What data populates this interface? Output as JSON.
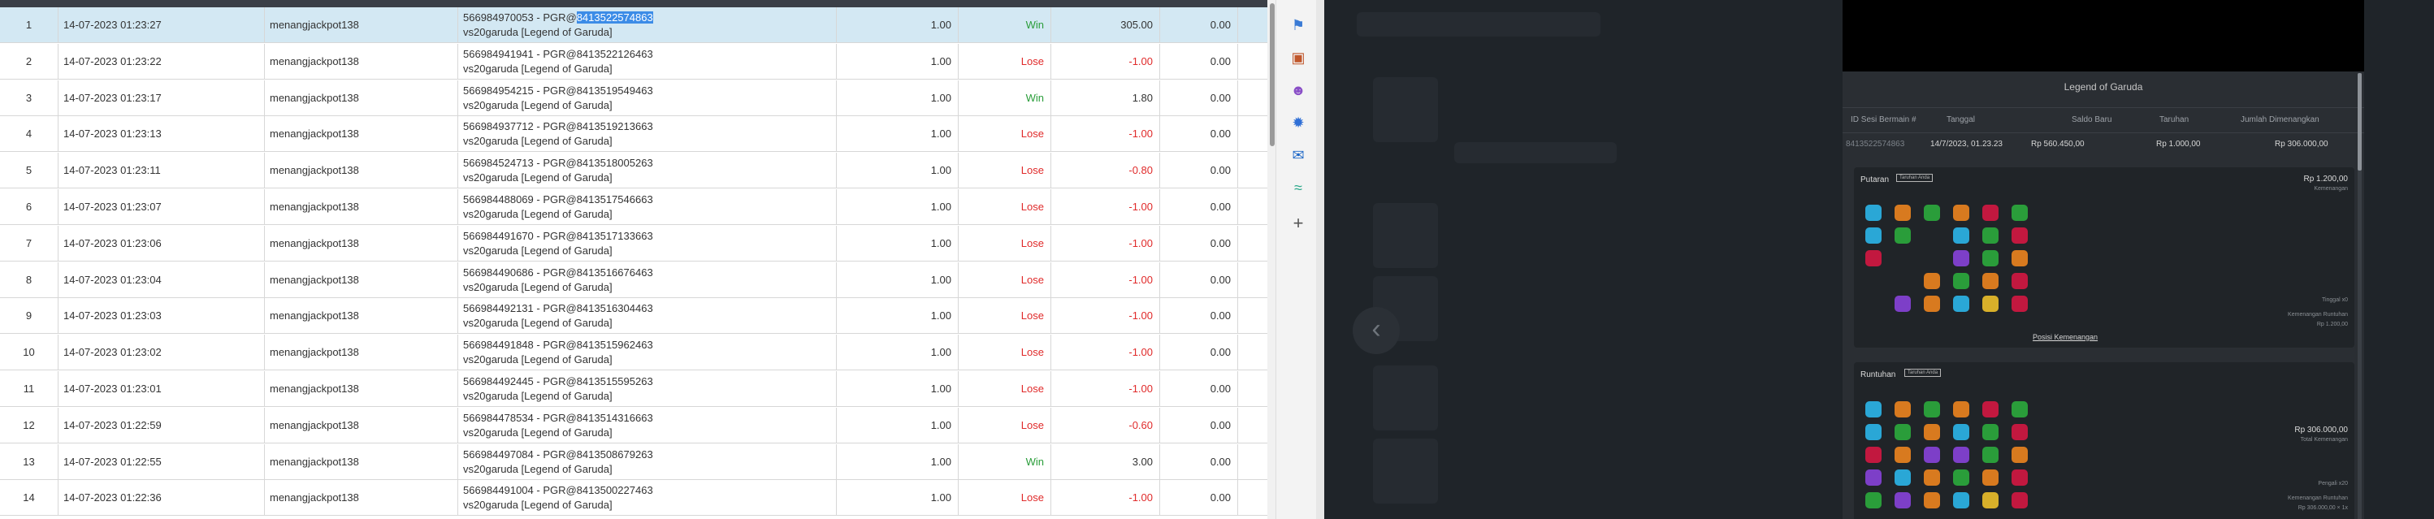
{
  "table": {
    "rows": [
      {
        "num": "1",
        "date": "14-07-2023 01:23:27",
        "user": "menangjackpot138",
        "desc_pre": "566984970053 - PGR@",
        "desc_hl": "8413522574863",
        "desc_line2": "vs20garuda [Legend of Garuda]",
        "bet": "1.00",
        "result": "Win",
        "win": "305.00",
        "fee": "0.00"
      },
      {
        "num": "2",
        "date": "14-07-2023 01:23:22",
        "user": "menangjackpot138",
        "desc_pre": "566984941941 - PGR@8413522126463",
        "desc_hl": "",
        "desc_line2": "vs20garuda [Legend of Garuda]",
        "bet": "1.00",
        "result": "Lose",
        "win": "-1.00",
        "fee": "0.00"
      },
      {
        "num": "3",
        "date": "14-07-2023 01:23:17",
        "user": "menangjackpot138",
        "desc_pre": "566984954215 - PGR@8413519549463",
        "desc_hl": "",
        "desc_line2": "vs20garuda [Legend of Garuda]",
        "bet": "1.00",
        "result": "Win",
        "win": "1.80",
        "fee": "0.00"
      },
      {
        "num": "4",
        "date": "14-07-2023 01:23:13",
        "user": "menangjackpot138",
        "desc_pre": "566984937712 - PGR@8413519213663",
        "desc_hl": "",
        "desc_line2": "vs20garuda [Legend of Garuda]",
        "bet": "1.00",
        "result": "Lose",
        "win": "-1.00",
        "fee": "0.00"
      },
      {
        "num": "5",
        "date": "14-07-2023 01:23:11",
        "user": "menangjackpot138",
        "desc_pre": "566984524713 - PGR@8413518005263",
        "desc_hl": "",
        "desc_line2": "vs20garuda [Legend of Garuda]",
        "bet": "1.00",
        "result": "Lose",
        "win": "-0.80",
        "fee": "0.00"
      },
      {
        "num": "6",
        "date": "14-07-2023 01:23:07",
        "user": "menangjackpot138",
        "desc_pre": "566984488069 - PGR@8413517546663",
        "desc_hl": "",
        "desc_line2": "vs20garuda [Legend of Garuda]",
        "bet": "1.00",
        "result": "Lose",
        "win": "-1.00",
        "fee": "0.00"
      },
      {
        "num": "7",
        "date": "14-07-2023 01:23:06",
        "user": "menangjackpot138",
        "desc_pre": "566984491670 - PGR@8413517133663",
        "desc_hl": "",
        "desc_line2": "vs20garuda [Legend of Garuda]",
        "bet": "1.00",
        "result": "Lose",
        "win": "-1.00",
        "fee": "0.00"
      },
      {
        "num": "8",
        "date": "14-07-2023 01:23:04",
        "user": "menangjackpot138",
        "desc_pre": "566984490686 - PGR@8413516676463",
        "desc_hl": "",
        "desc_line2": "vs20garuda [Legend of Garuda]",
        "bet": "1.00",
        "result": "Lose",
        "win": "-1.00",
        "fee": "0.00"
      },
      {
        "num": "9",
        "date": "14-07-2023 01:23:03",
        "user": "menangjackpot138",
        "desc_pre": "566984492131 - PGR@8413516304463",
        "desc_hl": "",
        "desc_line2": "vs20garuda [Legend of Garuda]",
        "bet": "1.00",
        "result": "Lose",
        "win": "-1.00",
        "fee": "0.00"
      },
      {
        "num": "10",
        "date": "14-07-2023 01:23:02",
        "user": "menangjackpot138",
        "desc_pre": "566984491848 - PGR@8413515962463",
        "desc_hl": "",
        "desc_line2": "vs20garuda [Legend of Garuda]",
        "bet": "1.00",
        "result": "Lose",
        "win": "-1.00",
        "fee": "0.00"
      },
      {
        "num": "11",
        "date": "14-07-2023 01:23:01",
        "user": "menangjackpot138",
        "desc_pre": "566984492445 - PGR@8413515595263",
        "desc_hl": "",
        "desc_line2": "vs20garuda [Legend of Garuda]",
        "bet": "1.00",
        "result": "Lose",
        "win": "-1.00",
        "fee": "0.00"
      },
      {
        "num": "12",
        "date": "14-07-2023 01:22:59",
        "user": "menangjackpot138",
        "desc_pre": "566984478534 - PGR@8413514316663",
        "desc_hl": "",
        "desc_line2": "vs20garuda [Legend of Garuda]",
        "bet": "1.00",
        "result": "Lose",
        "win": "-0.60",
        "fee": "0.00"
      },
      {
        "num": "13",
        "date": "14-07-2023 01:22:55",
        "user": "menangjackpot138",
        "desc_pre": "566984497084 - PGR@8413508679263",
        "desc_hl": "",
        "desc_line2": "vs20garuda [Legend of Garuda]",
        "bet": "1.00",
        "result": "Win",
        "win": "3.00",
        "fee": "0.00"
      },
      {
        "num": "14",
        "date": "14-07-2023 01:22:36",
        "user": "menangjackpot138",
        "desc_pre": "566984491004 - PGR@8413500227463",
        "desc_hl": "",
        "desc_line2": "vs20garuda [Legend of Garuda]",
        "bet": "1.00",
        "result": "Lose",
        "win": "-1.00",
        "fee": "0.00"
      }
    ]
  },
  "sidebar": {
    "icons": [
      "tag-icon",
      "briefcase-icon",
      "users-icon",
      "settings-icon",
      "outlook-icon",
      "edge-icon",
      "plus-icon"
    ]
  },
  "colors": {
    "win": "#2a9d3a",
    "lose": "#e02a2a",
    "selected_row": "#d3e8f3",
    "highlight": "#3c8ce7",
    "dark_bg": "#1f2429"
  },
  "game_panel": {
    "title": "Legend of Garuda",
    "headers": [
      "ID Sesi Bermain #",
      "Tanggal",
      "Saldo Baru",
      "Taruhan",
      "Jumlah Dimenangkan"
    ],
    "values": [
      "8413522574863",
      "14/7/2023, 01.23.23",
      "Rp 560.450,00",
      "Rp 1.000,00",
      "Rp 306.000,00"
    ],
    "spin_label": "Putaran",
    "spin_tag": "Taruhan Anda",
    "spin_amount": "Rp 1.200,00",
    "spin_amount_sub": "Kemenangan",
    "spin_side_1": "Tinggal x0",
    "spin_side_2": "Kemenangan Runtuhan",
    "spin_side_3": "Rp 1.200,00",
    "spin_link": "Posisi Kemenangan",
    "tumble_label": "Runtuhan",
    "tumble_tag": "Taruhan Anda",
    "tumble_amount": "Rp 306.000,00",
    "tumble_amount_sub": "Total Kemenangan",
    "tumble_side_1": "Pengali x20",
    "tumble_side_2": "Kemenangan Runtuhan",
    "tumble_side_3": "Rp 306.000,00 × 1x"
  }
}
